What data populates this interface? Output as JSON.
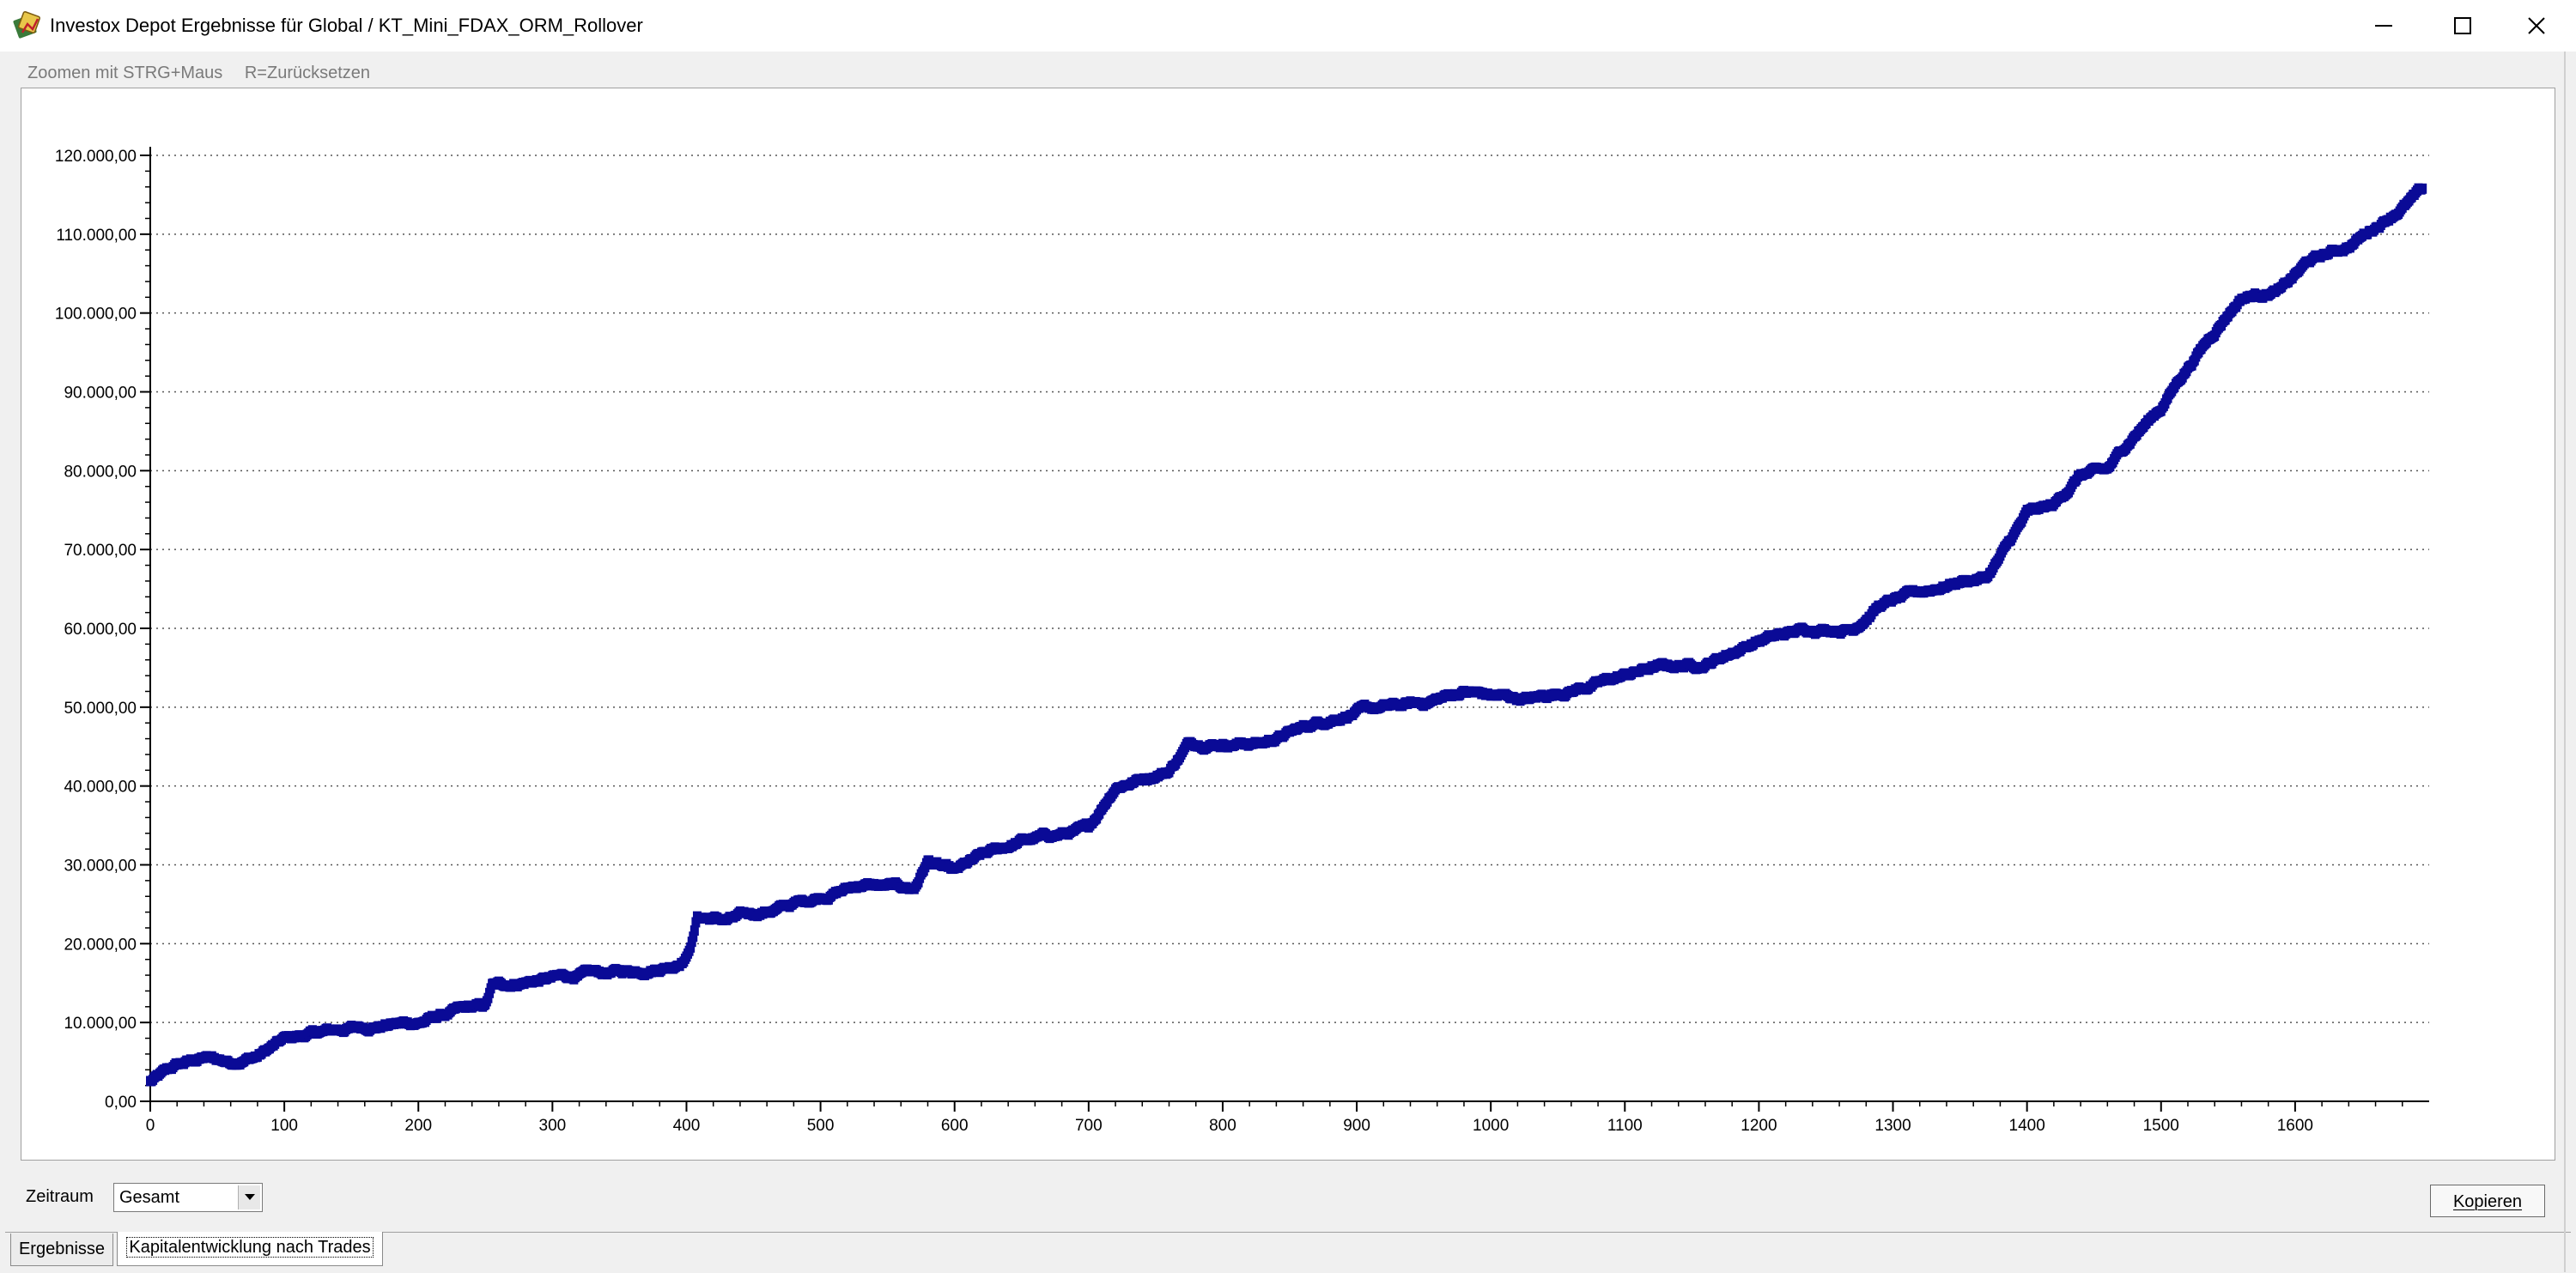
{
  "window": {
    "title": "Investox Depot Ergebnisse für Global / KT_Mini_FDAX_ORM_Rollover",
    "icon": "investox-app-icon",
    "controls": [
      "minimize-icon",
      "maximize-icon",
      "close-icon"
    ]
  },
  "hints": {
    "zoom": "Zoomen mit STRG+Maus",
    "reset": "R=Zurücksetzen"
  },
  "controls": {
    "zeitraum_label": "Zeitraum",
    "zeitraum_value": "Gesamt",
    "kopieren_label": "Kopieren"
  },
  "tabs": [
    {
      "label": "Ergebnisse",
      "active": false
    },
    {
      "label": "Kapitalentwicklung nach Trades",
      "active": true
    }
  ],
  "colors": {
    "series": "#0a0a96",
    "grid": "#555555"
  },
  "chart_data": {
    "type": "scatter",
    "title": "",
    "xlabel": "",
    "ylabel": "",
    "xlim": [
      0,
      1700
    ],
    "ylim": [
      0,
      120000
    ],
    "grid": "horizontal dotted",
    "legend": "none",
    "x_ticks": [
      "0",
      "100",
      "200",
      "300",
      "400",
      "500",
      "600",
      "700",
      "800",
      "900",
      "1000",
      "1100",
      "1200",
      "1300",
      "1400",
      "1500",
      "1600"
    ],
    "y_ticks": [
      "0,00",
      "10.000,00",
      "20.000,00",
      "30.000,00",
      "40.000,00",
      "50.000,00",
      "60.000,00",
      "70.000,00",
      "80.000,00",
      "90.000,00",
      "100.000,00",
      "110.000,00",
      "120.000,00"
    ],
    "series": [
      {
        "trend": [
          [
            0,
            2500
          ],
          [
            20,
            4500
          ],
          [
            40,
            5500
          ],
          [
            60,
            5000
          ],
          [
            80,
            5800
          ],
          [
            100,
            7800
          ],
          [
            120,
            8500
          ],
          [
            150,
            9300
          ],
          [
            180,
            9800
          ],
          [
            200,
            10000
          ],
          [
            230,
            11500
          ],
          [
            250,
            12000
          ],
          [
            255,
            14500
          ],
          [
            280,
            15200
          ],
          [
            320,
            16000
          ],
          [
            360,
            16500
          ],
          [
            390,
            17300
          ],
          [
            400,
            18500
          ],
          [
            405,
            21000
          ],
          [
            408,
            23500
          ],
          [
            430,
            23000
          ],
          [
            470,
            24500
          ],
          [
            500,
            26000
          ],
          [
            530,
            27500
          ],
          [
            570,
            27000
          ],
          [
            580,
            30500
          ],
          [
            600,
            29000
          ],
          [
            620,
            31000
          ],
          [
            650,
            33000
          ],
          [
            700,
            34500
          ],
          [
            720,
            40000
          ],
          [
            760,
            42000
          ],
          [
            775,
            45500
          ],
          [
            800,
            45500
          ],
          [
            830,
            45500
          ],
          [
            870,
            48000
          ],
          [
            900,
            49500
          ],
          [
            950,
            50500
          ],
          [
            980,
            52000
          ],
          [
            1000,
            51500
          ],
          [
            1030,
            51000
          ],
          [
            1080,
            53000
          ],
          [
            1120,
            55000
          ],
          [
            1160,
            55500
          ],
          [
            1200,
            58500
          ],
          [
            1240,
            60000
          ],
          [
            1270,
            60000
          ],
          [
            1290,
            63000
          ],
          [
            1320,
            64500
          ],
          [
            1350,
            66000
          ],
          [
            1370,
            66500
          ],
          [
            1380,
            69000
          ],
          [
            1400,
            74500
          ],
          [
            1420,
            75500
          ],
          [
            1440,
            79500
          ],
          [
            1460,
            80000
          ],
          [
            1480,
            84500
          ],
          [
            1500,
            88000
          ],
          [
            1515,
            92000
          ],
          [
            1530,
            95500
          ],
          [
            1550,
            100000
          ],
          [
            1560,
            102000
          ],
          [
            1590,
            103000
          ],
          [
            1610,
            106500
          ],
          [
            1640,
            108500
          ],
          [
            1660,
            111000
          ],
          [
            1680,
            113500
          ],
          [
            1695,
            115500
          ]
        ],
        "noise_amplitude": 700,
        "point_count": 1700
      }
    ]
  }
}
